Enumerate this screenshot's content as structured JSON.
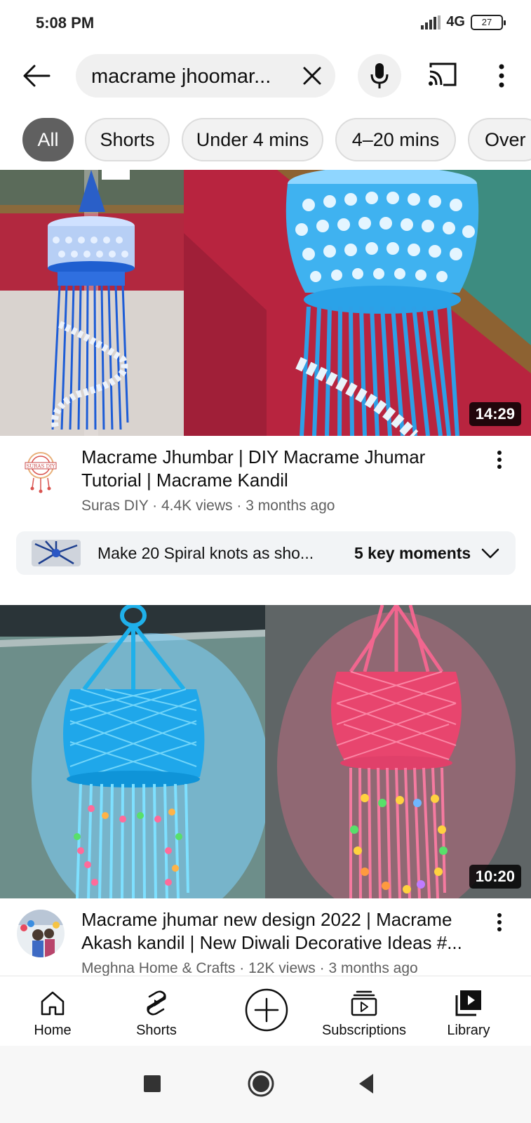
{
  "status_bar": {
    "time": "5:08 PM",
    "network": "4G",
    "battery": "27"
  },
  "search": {
    "query": "macrame jhoomar..."
  },
  "chips": [
    {
      "label": "All",
      "active": true
    },
    {
      "label": "Shorts",
      "active": false
    },
    {
      "label": "Under 4 mins",
      "active": false
    },
    {
      "label": "4–20 mins",
      "active": false
    },
    {
      "label": "Over",
      "active": false
    }
  ],
  "videos": [
    {
      "duration": "14:29",
      "title": "Macrame Jhumbar | DIY Macrame Jhumar Tutorial | Macrame Kandil",
      "channel": "Suras DIY",
      "views": "4.4K views",
      "age": "3 months ago",
      "subtitle": "Suras DIY · 4.4K views · 3 months ago",
      "avatar_text": "SURAS DIY",
      "key_moments": {
        "text": "Make 20 Spiral knots as sho...",
        "count": "5 key moments"
      }
    },
    {
      "duration": "10:20",
      "title": "Macrame jhumar new design 2022 | Macrame Akash kandil | New Diwali Decorative Ideas #...",
      "channel": "Meghna Home & Crafts",
      "views": "12K views",
      "age": "3 months ago",
      "subtitle": "Meghna Home & Crafts · 12K views · 3 months ago"
    }
  ],
  "bottom_nav": [
    {
      "label": "Home",
      "icon": "home-icon"
    },
    {
      "label": "Shorts",
      "icon": "shorts-icon"
    },
    {
      "label": "",
      "icon": "create-icon"
    },
    {
      "label": "Subscriptions",
      "icon": "subscriptions-icon"
    },
    {
      "label": "Library",
      "icon": "library-icon"
    }
  ],
  "colors": {
    "chip_active": "#606060",
    "chip_bg": "#f2f2f2",
    "text_secondary": "#606060",
    "lamp_blue": "#1f7ae0",
    "lamp_cyan": "#2bb6e8",
    "lamp_pink": "#f0467e"
  }
}
